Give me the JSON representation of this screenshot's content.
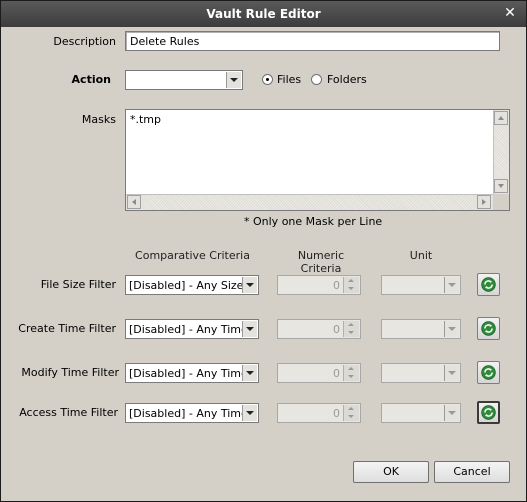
{
  "window": {
    "title": "Vault Rule Editor"
  },
  "description": {
    "label": "Description",
    "value": "Delete Rules"
  },
  "action": {
    "label": "Action",
    "value": "",
    "options": [
      {
        "label": "Files",
        "checked": true
      },
      {
        "label": "Folders",
        "checked": false
      }
    ]
  },
  "masks": {
    "label": "Masks",
    "value": "*.tmp",
    "hint": "* Only one Mask per Line"
  },
  "columns": {
    "comparative": "Comparative Criteria",
    "numeric": "Numeric Criteria",
    "unit": "Unit"
  },
  "filters": [
    {
      "label": "File Size Filter",
      "criteria": "[Disabled] - Any Size",
      "numeric": "0",
      "unit": ""
    },
    {
      "label": "Create Time Filter",
      "criteria": "[Disabled] - Any Time",
      "numeric": "0",
      "unit": ""
    },
    {
      "label": "Modify Time Filter",
      "criteria": "[Disabled] - Any Time",
      "numeric": "0",
      "unit": ""
    },
    {
      "label": "Access Time Filter",
      "criteria": "[Disabled] - Any Time",
      "numeric": "0",
      "unit": ""
    }
  ],
  "buttons": {
    "ok": "OK",
    "cancel": "Cancel"
  },
  "icons": {
    "close": "close-icon",
    "refresh": "refresh-icon"
  },
  "colors": {
    "titlebar": "#4a4a4a",
    "dialog_bg": "#d4d0c8",
    "refresh_green": "#2e8b3a"
  }
}
